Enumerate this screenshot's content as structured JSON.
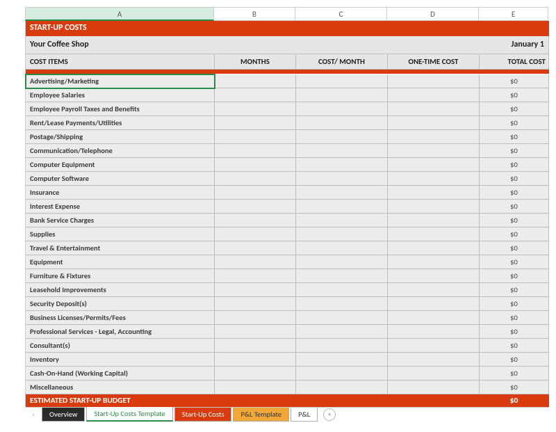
{
  "columns": {
    "A": "A",
    "B": "B",
    "C": "C",
    "D": "D",
    "E": "E"
  },
  "title": "START-UP COSTS",
  "company": "Your Coffee Shop",
  "date": "January 1",
  "headers": {
    "items": "COST ITEMS",
    "months": "MONTHS",
    "cost_month": "COST/ MONTH",
    "one_time": "ONE-TIME COST",
    "total": "TOTAL COST"
  },
  "items": [
    {
      "name": "Advertising/Marketing",
      "total": "$0"
    },
    {
      "name": "Employee Salaries",
      "total": "$0"
    },
    {
      "name": "Employee Payroll Taxes and Benefits",
      "total": "$0"
    },
    {
      "name": "Rent/Lease Payments/Utilities",
      "total": "$0"
    },
    {
      "name": "Postage/Shipping",
      "total": "$0"
    },
    {
      "name": "Communication/Telephone",
      "total": "$0"
    },
    {
      "name": "Computer Equipment",
      "total": "$0"
    },
    {
      "name": "Computer Software",
      "total": "$0"
    },
    {
      "name": "Insurance",
      "total": "$0"
    },
    {
      "name": "Interest Expense",
      "total": "$0"
    },
    {
      "name": "Bank Service Charges",
      "total": "$0"
    },
    {
      "name": "Supplies",
      "total": "$0"
    },
    {
      "name": "Travel & Entertainment",
      "total": "$0"
    },
    {
      "name": "Equipment",
      "total": "$0"
    },
    {
      "name": "Furniture & Fixtures",
      "total": "$0"
    },
    {
      "name": "Leasehold Improvements",
      "total": "$0"
    },
    {
      "name": "Security Deposit(s)",
      "total": "$0"
    },
    {
      "name": "Business Licenses/Permits/Fees",
      "total": "$0"
    },
    {
      "name": "Professional Services - Legal, Accounting",
      "total": "$0"
    },
    {
      "name": "Consultant(s)",
      "total": "$0"
    },
    {
      "name": "Inventory",
      "total": "$0"
    },
    {
      "name": "Cash-On-Hand (Working Capital)",
      "total": "$0"
    },
    {
      "name": "Miscellaneous",
      "total": "$0"
    }
  ],
  "budget": {
    "label": "ESTIMATED START-UP BUDGET",
    "total": "$0"
  },
  "tabs": {
    "overview": "Overview",
    "template": "Start-Up Costs Template",
    "startup": "Start-Up Costs",
    "pltmpl": "P&L Template",
    "pl": "P&L"
  },
  "icons": {
    "nav_prev": "‹",
    "add": "+"
  }
}
